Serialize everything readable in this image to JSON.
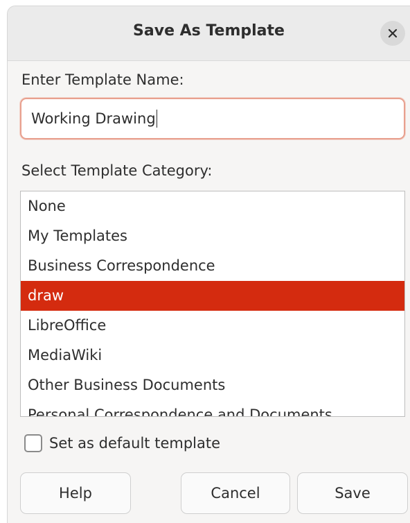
{
  "dialog": {
    "title": "Save As Template",
    "close_icon": "close-icon"
  },
  "name_section": {
    "label": "Enter Template Name:",
    "value": "Working Drawing"
  },
  "category_section": {
    "label": "Select Template Category:",
    "items": [
      {
        "label": "None",
        "selected": false
      },
      {
        "label": "My Templates",
        "selected": false
      },
      {
        "label": "Business Correspondence",
        "selected": false
      },
      {
        "label": "draw",
        "selected": true
      },
      {
        "label": "LibreOffice",
        "selected": false
      },
      {
        "label": "MediaWiki",
        "selected": false
      },
      {
        "label": "Other Business Documents",
        "selected": false
      },
      {
        "label": "Personal Correspondence and Documents",
        "selected": false
      }
    ]
  },
  "default_checkbox": {
    "label": "Set as default template",
    "checked": false
  },
  "buttons": {
    "help": "Help",
    "cancel": "Cancel",
    "save": "Save"
  },
  "colors": {
    "selection": "#d42b0f",
    "focus_border": "#e8a08f",
    "titlebar": "#ebebeb",
    "dialog_bg": "#f6f5f4"
  }
}
